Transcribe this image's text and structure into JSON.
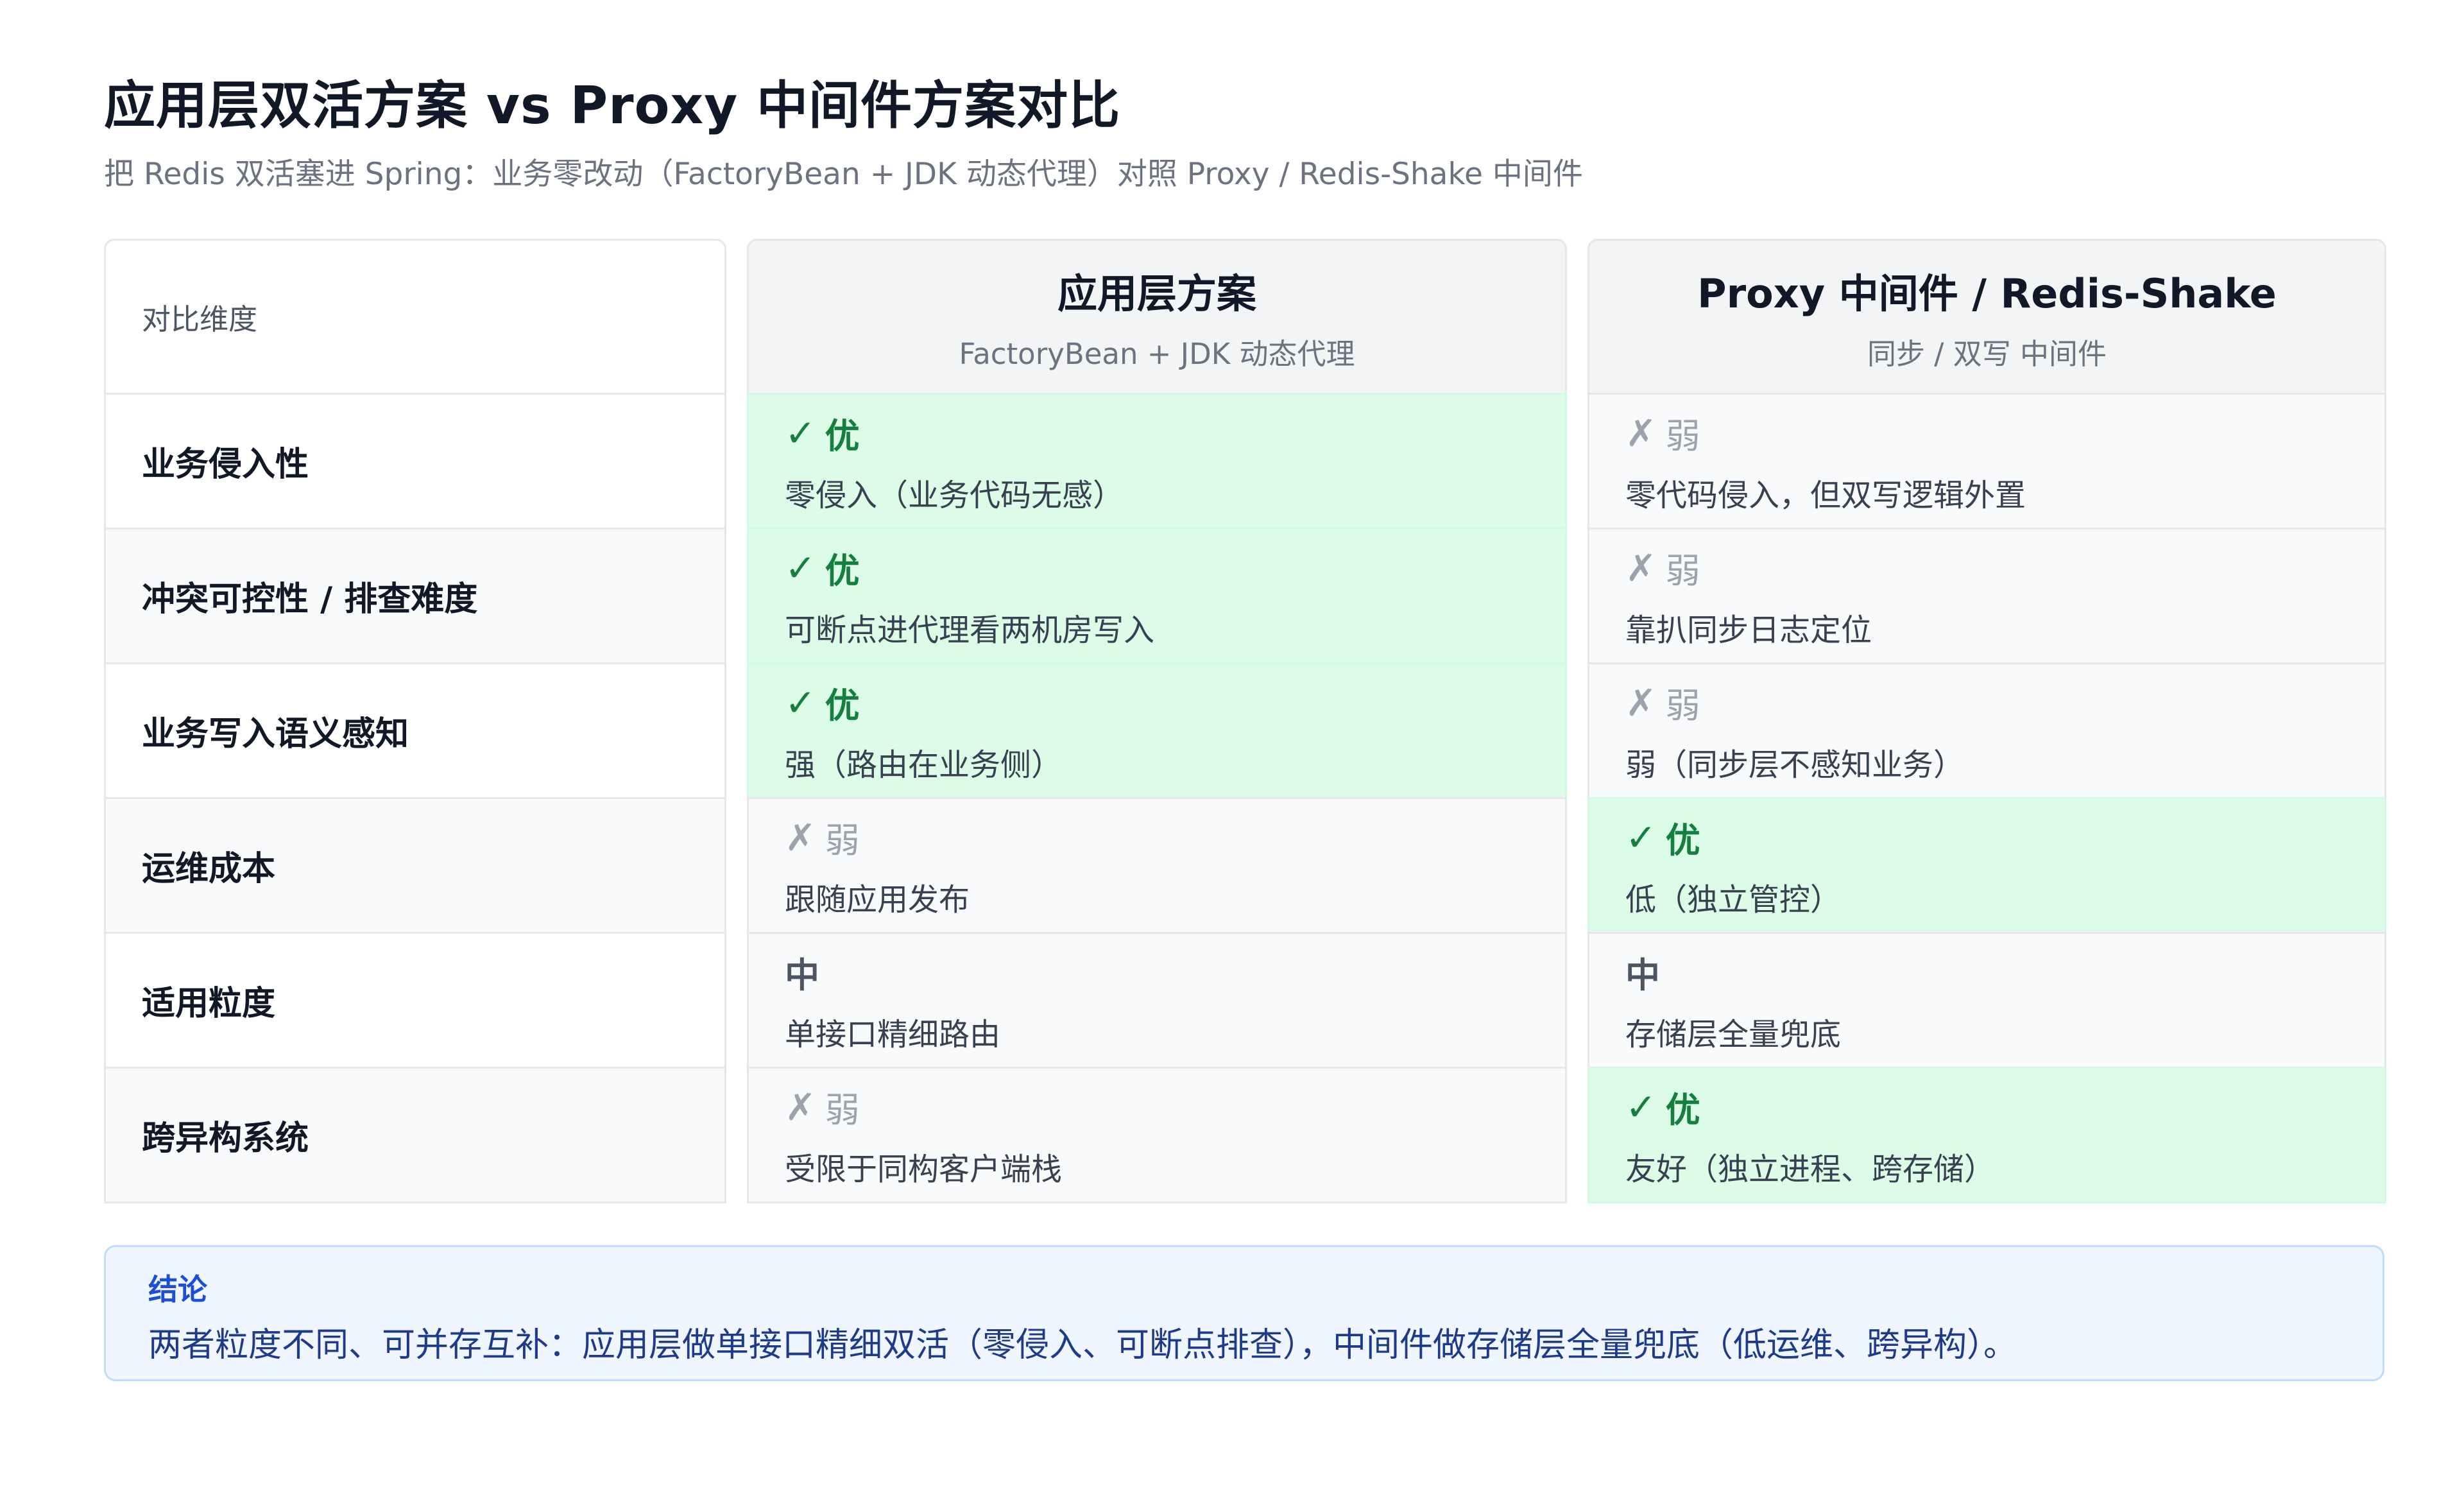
{
  "title": "应用层双活方案 vs Proxy 中间件方案对比",
  "subtitle": "把 Redis 双活塞进 Spring：业务零改动（FactoryBean + JDK 动态代理）对照 Proxy / Redis-Shake 中间件",
  "table": {
    "dimension_header": "对比维度",
    "columns": [
      {
        "title": "应用层方案",
        "subtitle": "FactoryBean + JDK 动态代理"
      },
      {
        "title": "Proxy 中间件 / Redis-Shake",
        "subtitle": "同步 / 双写 中间件"
      }
    ],
    "rows": [
      {
        "label": "业务侵入性",
        "cells": [
          {
            "rating": "good",
            "mark": "✓",
            "verdict": "优",
            "desc": "零侵入（业务代码无感）"
          },
          {
            "rating": "bad",
            "mark": "✗",
            "verdict": "弱",
            "desc": "零代码侵入，但双写逻辑外置"
          }
        ]
      },
      {
        "label": "冲突可控性 / 排查难度",
        "cells": [
          {
            "rating": "good",
            "mark": "✓",
            "verdict": "优",
            "desc": "可断点进代理看两机房写入"
          },
          {
            "rating": "bad",
            "mark": "✗",
            "verdict": "弱",
            "desc": "靠扒同步日志定位"
          }
        ]
      },
      {
        "label": "业务写入语义感知",
        "cells": [
          {
            "rating": "good",
            "mark": "✓",
            "verdict": "优",
            "desc": "强（路由在业务侧）"
          },
          {
            "rating": "bad",
            "mark": "✗",
            "verdict": "弱",
            "desc": "弱（同步层不感知业务）"
          }
        ]
      },
      {
        "label": "运维成本",
        "cells": [
          {
            "rating": "bad",
            "mark": "✗",
            "verdict": "弱",
            "desc": "跟随应用发布"
          },
          {
            "rating": "good",
            "mark": "✓",
            "verdict": "优",
            "desc": "低（独立管控）"
          }
        ]
      },
      {
        "label": "适用粒度",
        "cells": [
          {
            "rating": "mid",
            "mark": "",
            "verdict": "中",
            "desc": "单接口精细路由"
          },
          {
            "rating": "mid",
            "mark": "",
            "verdict": "中",
            "desc": "存储层全量兜底"
          }
        ]
      },
      {
        "label": "跨异构系统",
        "cells": [
          {
            "rating": "bad",
            "mark": "✗",
            "verdict": "弱",
            "desc": "受限于同构客户端栈"
          },
          {
            "rating": "good",
            "mark": "✓",
            "verdict": "优",
            "desc": "友好（独立进程、跨存储）"
          }
        ]
      }
    ]
  },
  "conclusion": {
    "label": "结论",
    "text": "两者粒度不同、可并存互补：应用层做单接口精细双活（零侵入、可断点排查），中间件做存储层全量兜底（低运维、跨异构）。"
  },
  "colors": {
    "good_bg": "#dcfce7",
    "good_text": "#15803d",
    "bad_text": "#9ca3af",
    "conclusion_bg": "#eff6ff",
    "conclusion_text": "#1e3a8a"
  }
}
